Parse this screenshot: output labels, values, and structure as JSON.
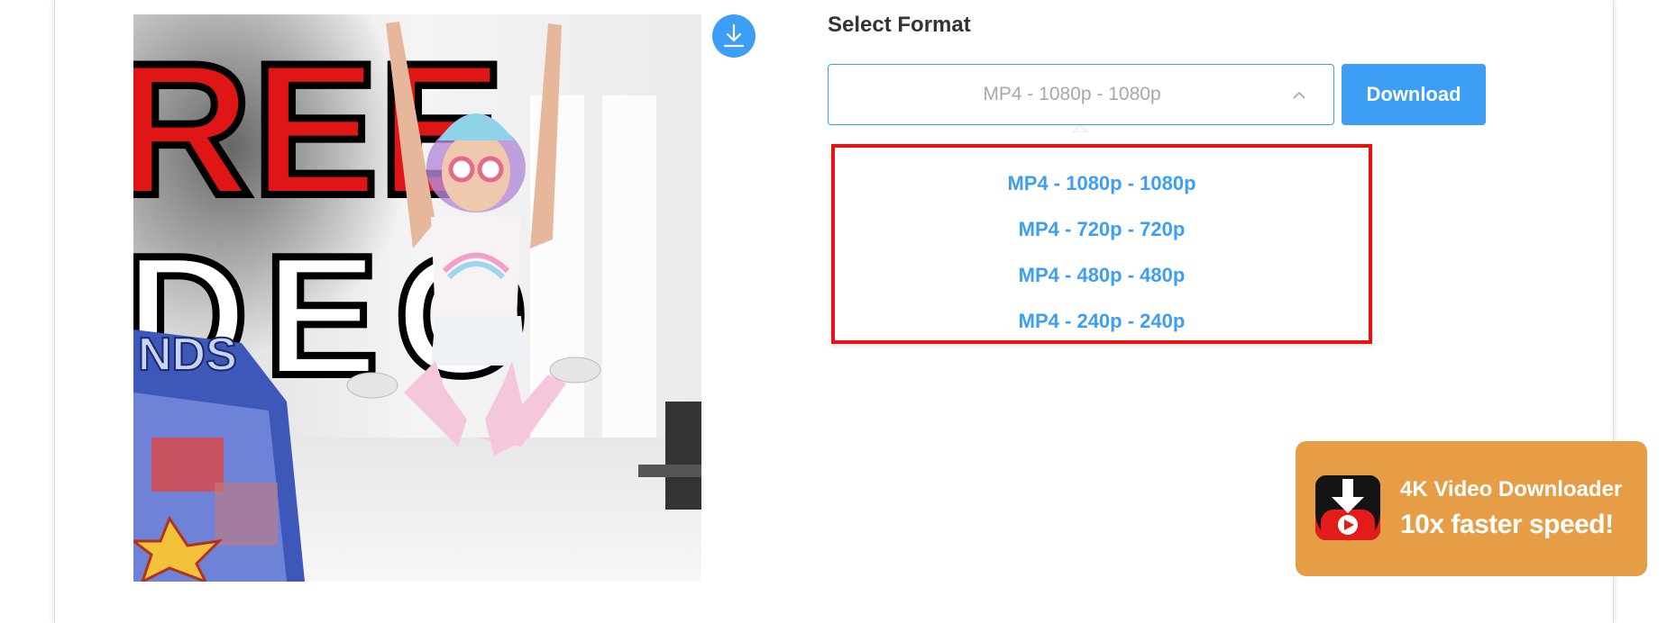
{
  "format_section": {
    "label": "Select Format",
    "selected_value": "MP4 - 1080p - 1080p",
    "options": [
      "MP4 - 1080p - 1080p",
      "MP4 - 720p - 720p",
      "MP4 - 480p - 480p",
      "MP4 - 240p - 240p"
    ]
  },
  "download_button": {
    "label": "Download"
  },
  "thumbnail": {
    "overlay_text_top": "REE",
    "overlay_text_mid": "DEO",
    "overlay_text_side": "NDS"
  },
  "promo": {
    "title": "4K Video Downloader",
    "tagline": "10x faster speed!"
  },
  "icons": {
    "download_circle": "download-arrow-icon",
    "select_chevron": "chevron-up-icon",
    "promo_app": "downloader-app-icon"
  },
  "colors": {
    "accent": "#3c9ef5",
    "highlight_border": "#e81212",
    "promo_bg": "#e79d45"
  }
}
